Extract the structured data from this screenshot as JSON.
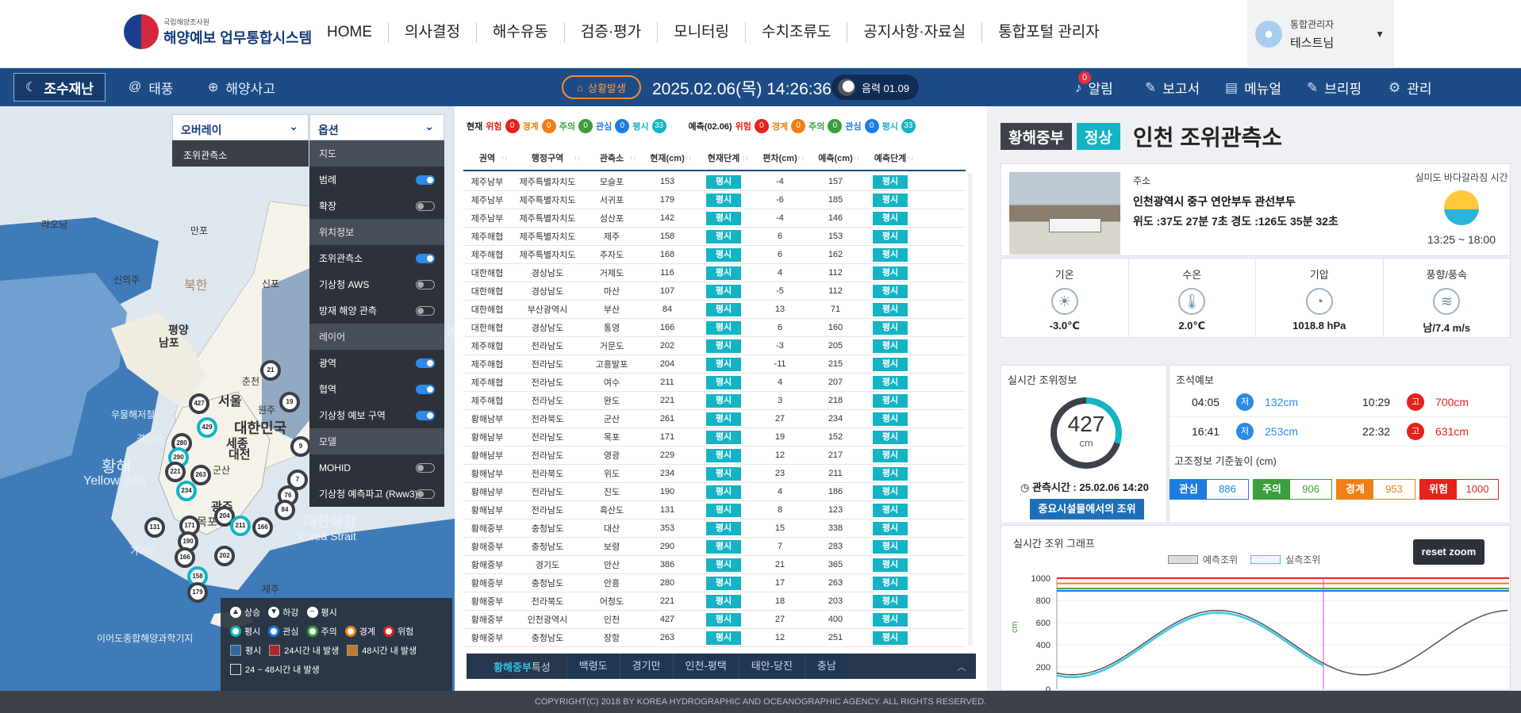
{
  "brand": {
    "small": "국립해양조사원",
    "title": "해양예보 업무통합시스템"
  },
  "gnav": [
    "HOME",
    "의사결정",
    "해수유동",
    "검증·평가",
    "모니터링",
    "수치조류도",
    "공지사항·자료실",
    "통합포털 관리자"
  ],
  "user": {
    "role": "통합관리자",
    "name": "테스트님"
  },
  "subnav": {
    "tabs": [
      "조수재난",
      "태풍",
      "해양사고"
    ],
    "alert": "상황발생",
    "datetime": "2025.02.06(목) 14:26:36",
    "lunar": "음력 01.09"
  },
  "rightnav": {
    "alarm": "알림",
    "alarm_count": "0",
    "report": "보고서",
    "manual": "메뉴얼",
    "briefing": "브리핑",
    "admin": "관리"
  },
  "map": {
    "overlay_label": "오버레이",
    "option_label": "옵션",
    "overlay_item": "조위관측소",
    "options": [
      {
        "type": "sec",
        "label": "지도"
      },
      {
        "type": "item",
        "label": "범례",
        "on": true
      },
      {
        "type": "item",
        "label": "확장",
        "on": false
      },
      {
        "type": "sec",
        "label": "위치정보"
      },
      {
        "type": "item",
        "label": "조위관측소",
        "on": true
      },
      {
        "type": "item",
        "label": "기상청 AWS",
        "on": false
      },
      {
        "type": "item",
        "label": "방재 해양 관측",
        "on": false
      },
      {
        "type": "sec",
        "label": "레이어"
      },
      {
        "type": "item",
        "label": "광역",
        "on": true
      },
      {
        "type": "item",
        "label": "협역",
        "on": true
      },
      {
        "type": "item",
        "label": "기상청 예보 구역",
        "on": true
      },
      {
        "type": "sec",
        "label": "모델"
      },
      {
        "type": "item",
        "label": "MOHID",
        "on": false
      },
      {
        "type": "item",
        "label": "기상청 예측파고 (Rww3)",
        "on": false
      }
    ],
    "labels": [
      "라오닝",
      "만포",
      "신의주",
      "북한",
      "신포",
      "평양",
      "남포",
      "서울",
      "춘천",
      "원주",
      "대한민국",
      "세종",
      "대전",
      "광주",
      "목포",
      "군산",
      "황해",
      "Yellow Sea",
      "대한해협",
      "Korea Strait",
      "가거도",
      "우물해저철",
      "격렬비",
      "이어도종합해양과학기지",
      "동",
      "제주"
    ],
    "markers": [
      "427",
      "429",
      "280",
      "290",
      "221",
      "263",
      "234",
      "171",
      "190",
      "166",
      "158",
      "179",
      "131",
      "204",
      "202",
      "211",
      "166",
      "76",
      "84",
      "19",
      "21",
      "7",
      "9"
    ],
    "legend": {
      "up": "상승",
      "down": "하강",
      "flat": "평시",
      "levels": [
        "평시",
        "관심",
        "주의",
        "경계",
        "위험"
      ],
      "events": [
        "평시",
        "24시간 내 발생",
        "48시간 내 발생",
        "24 ~ 48시간 내 발생"
      ]
    }
  },
  "summary": {
    "now_label": "현재",
    "fc_label": "예측(02.06)",
    "labels": [
      "위험",
      "경계",
      "주의",
      "관심",
      "평시"
    ],
    "now_counts": [
      "0",
      "0",
      "0",
      "0",
      "33"
    ],
    "fc_counts": [
      "0",
      "0",
      "0",
      "0",
      "33"
    ]
  },
  "table": {
    "headers": [
      "권역",
      "행정구역",
      "관측소",
      "현재(cm)",
      "현재단계",
      "편차(cm)",
      "예측(cm)",
      "예측단계"
    ],
    "rows": [
      [
        "제주남부",
        "제주특별자치도",
        "모슬포",
        "153",
        "평시",
        "-4",
        "157",
        "평시"
      ],
      [
        "제주남부",
        "제주특별자치도",
        "서귀포",
        "179",
        "평시",
        "-6",
        "185",
        "평시"
      ],
      [
        "제주남부",
        "제주특별자치도",
        "성산포",
        "142",
        "평시",
        "-4",
        "146",
        "평시"
      ],
      [
        "제주해협",
        "제주특별자치도",
        "제주",
        "158",
        "평시",
        "6",
        "153",
        "평시"
      ],
      [
        "제주해협",
        "제주특별자치도",
        "추자도",
        "168",
        "평시",
        "6",
        "162",
        "평시"
      ],
      [
        "대한해협",
        "경상남도",
        "거제도",
        "116",
        "평시",
        "4",
        "112",
        "평시"
      ],
      [
        "대한해협",
        "경상남도",
        "마산",
        "107",
        "평시",
        "-5",
        "112",
        "평시"
      ],
      [
        "대한해협",
        "부산광역시",
        "부산",
        "84",
        "평시",
        "13",
        "71",
        "평시"
      ],
      [
        "대한해협",
        "경상남도",
        "통영",
        "166",
        "평시",
        "6",
        "160",
        "평시"
      ],
      [
        "제주해협",
        "전라남도",
        "거문도",
        "202",
        "평시",
        "-3",
        "205",
        "평시"
      ],
      [
        "제주해협",
        "전라남도",
        "고흥발포",
        "204",
        "평시",
        "-11",
        "215",
        "평시"
      ],
      [
        "제주해협",
        "전라남도",
        "여수",
        "211",
        "평시",
        "4",
        "207",
        "평시"
      ],
      [
        "제주해협",
        "전라남도",
        "완도",
        "221",
        "평시",
        "3",
        "218",
        "평시"
      ],
      [
        "황해남부",
        "전라북도",
        "군산",
        "261",
        "평시",
        "27",
        "234",
        "평시"
      ],
      [
        "황해남부",
        "전라남도",
        "목포",
        "171",
        "평시",
        "19",
        "152",
        "평시"
      ],
      [
        "황해남부",
        "전라남도",
        "영광",
        "229",
        "평시",
        "12",
        "217",
        "평시"
      ],
      [
        "황해남부",
        "전라북도",
        "위도",
        "234",
        "평시",
        "23",
        "211",
        "평시"
      ],
      [
        "황해남부",
        "전라남도",
        "진도",
        "190",
        "평시",
        "4",
        "186",
        "평시"
      ],
      [
        "황해남부",
        "전라남도",
        "흑산도",
        "131",
        "평시",
        "8",
        "123",
        "평시"
      ],
      [
        "황해중부",
        "충청남도",
        "대산",
        "353",
        "평시",
        "15",
        "338",
        "평시"
      ],
      [
        "황해중부",
        "충청남도",
        "보령",
        "290",
        "평시",
        "7",
        "283",
        "평시"
      ],
      [
        "황해중부",
        "경기도",
        "안산",
        "386",
        "평시",
        "21",
        "365",
        "평시"
      ],
      [
        "황해중부",
        "충청남도",
        "안흥",
        "280",
        "평시",
        "17",
        "263",
        "평시"
      ],
      [
        "황해중부",
        "전라북도",
        "어청도",
        "221",
        "평시",
        "18",
        "203",
        "평시"
      ],
      [
        "황해중부",
        "인천광역시",
        "인천",
        "427",
        "평시",
        "27",
        "400",
        "평시"
      ],
      [
        "황해중부",
        "충청남도",
        "장항",
        "263",
        "평시",
        "12",
        "251",
        "평시"
      ]
    ]
  },
  "tabbar": {
    "title": "황해중부",
    "title_suffix": "특성",
    "tabs": [
      "백령도",
      "경기만",
      "인천-평택",
      "태안-당진",
      "충남"
    ]
  },
  "station": {
    "region": "황해중부",
    "status": "정상",
    "name": "인천 조위관측소",
    "addr_label": "주소",
    "address": "인천광역시 중구 연안부두 관선부두",
    "coord": "위도 :37도 27분 7초   경도 :126도 35분 32초",
    "sea_title": "실미도 바다갈라짐 시간",
    "sea_time": "13:25 ~ 18:00"
  },
  "metrics": [
    {
      "label": "기온",
      "value": "-3.0℃",
      "icon": "sun-icon",
      "glyph": "☀"
    },
    {
      "label": "수온",
      "value": "2.0℃",
      "icon": "thermometer-icon",
      "glyph": "🌡"
    },
    {
      "label": "기압",
      "value": "1018.8 hPa",
      "icon": "pressure-icon",
      "glyph": "◔"
    },
    {
      "label": "풍향/풍속",
      "value": "남/7.4 m/s",
      "icon": "wind-icon",
      "glyph": "≋"
    }
  ],
  "realtime": {
    "title": "실시간 조위정보",
    "value": "427",
    "unit": "cm",
    "fill_fraction": 0.3,
    "obs_time": "관측시간 : 25.02.06 14:20",
    "button": "중요시설물에서의 조위"
  },
  "forecast": {
    "title": "조석예보",
    "items": [
      {
        "time": "04:05",
        "type": "저",
        "value": "132cm"
      },
      {
        "time": "10:29",
        "type": "고",
        "value": "700cm"
      },
      {
        "time": "16:41",
        "type": "저",
        "value": "253cm"
      },
      {
        "time": "22:32",
        "type": "고",
        "value": "631cm"
      }
    ],
    "ref_title": "고조정보 기준높이 (cm)",
    "refs": [
      {
        "label": "관심",
        "value": "886",
        "color": "#1d7ce0"
      },
      {
        "label": "주의",
        "value": "906",
        "color": "#3c9e3c"
      },
      {
        "label": "경계",
        "value": "953",
        "color": "#f07f15"
      },
      {
        "label": "위험",
        "value": "1000",
        "color": "#e5231b"
      }
    ]
  },
  "graph": {
    "title": "실시간 조위 그래프",
    "legend_fc": "예측조위",
    "legend_obs": "실측조위",
    "reset": "reset zoom",
    "ylabel": "cm",
    "yticks": [
      "1000",
      "800",
      "600",
      "400",
      "200",
      "0"
    ]
  },
  "footer": "COPYRIGHT(C) 2018 BY KOREA HYDROGRAPHIC AND OCEANOGRAPHIC AGENCY. ALL RIGHTS RESERVED."
}
